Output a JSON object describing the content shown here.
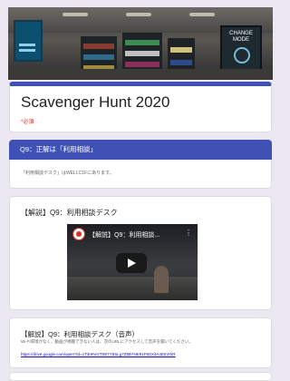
{
  "form": {
    "title": "Scavenger Hunt 2020",
    "required_note": "*必須"
  },
  "header_image": {
    "right_screen_text": "CHANGE MODE"
  },
  "section": {
    "header": "Q9：正解は「利用相談」",
    "body_text": "「利用相談デスク」はWELLC1Fにあります。"
  },
  "video_card": {
    "title": "【解説】Q9：利用相談デスク",
    "video_title": "【解説】Q9：利用相談...",
    "menu_icon": "⋮"
  },
  "audio_card": {
    "title": "【解説】Q9：利用相談デスク（音声）",
    "description": "Wi-Fi環境がなく、動画が視聴できない人は、次のURLにアクセスして音声を聞いてください。",
    "link": "https://drive.google.com/open?id=1T3nPoGTtW7Y5SLg7Z8B7s9r81F8SX4A4EtnXhR"
  },
  "colors": {
    "accent": "#3f51b5",
    "background": "#ece8f2",
    "required": "#d93025",
    "link": "#1a0dab"
  }
}
